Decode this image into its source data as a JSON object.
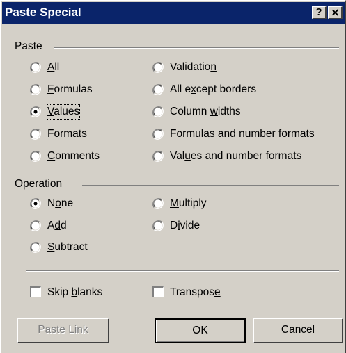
{
  "window": {
    "title": "Paste Special",
    "help_label": "?"
  },
  "paste": {
    "group_label": "Paste",
    "options": [
      {
        "pre": "",
        "key": "A",
        "post": "ll",
        "selected": false
      },
      {
        "pre": "",
        "key": "F",
        "post": "ormulas",
        "selected": false
      },
      {
        "pre": "",
        "key": "V",
        "post": "alues",
        "selected": true
      },
      {
        "pre": "Forma",
        "key": "t",
        "post": "s",
        "selected": false
      },
      {
        "pre": "",
        "key": "C",
        "post": "omments",
        "selected": false
      },
      {
        "pre": "Validatio",
        "key": "n",
        "post": "",
        "selected": false
      },
      {
        "pre": "All e",
        "key": "x",
        "post": "cept borders",
        "selected": false
      },
      {
        "pre": "Column ",
        "key": "w",
        "post": "idths",
        "selected": false
      },
      {
        "pre": "F",
        "key": "o",
        "post": "rmulas and number formats",
        "selected": false
      },
      {
        "pre": "Val",
        "key": "u",
        "post": "es and number formats",
        "selected": false
      }
    ]
  },
  "operation": {
    "group_label": "Operation",
    "options": [
      {
        "pre": "N",
        "key": "o",
        "post": "ne",
        "selected": true
      },
      {
        "pre": "A",
        "key": "d",
        "post": "d",
        "selected": false
      },
      {
        "pre": "",
        "key": "S",
        "post": "ubtract",
        "selected": false
      },
      {
        "pre": "",
        "key": "M",
        "post": "ultiply",
        "selected": false
      },
      {
        "pre": "D",
        "key": "i",
        "post": "vide",
        "selected": false
      }
    ]
  },
  "checkboxes": {
    "skip_blanks": {
      "pre": "Skip ",
      "key": "b",
      "post": "lanks",
      "checked": false
    },
    "transpose": {
      "pre": "Transpos",
      "key": "e",
      "post": "",
      "checked": false
    }
  },
  "buttons": {
    "paste_link": "Paste Link",
    "ok": "OK",
    "cancel": "Cancel"
  }
}
